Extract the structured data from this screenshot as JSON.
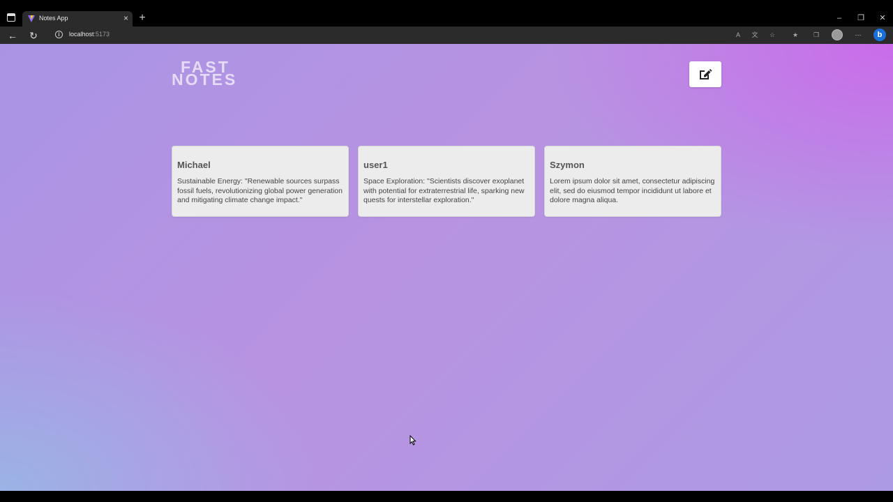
{
  "browser": {
    "tab_title": "Notes App",
    "tab_close": "×",
    "new_tab": "+",
    "url_host": "localhost",
    "url_port": ":5173",
    "window_minimize": "–",
    "window_restore": "❐",
    "window_close": "✕"
  },
  "app": {
    "logo_line1": "FAST",
    "logo_line2": "NOTES",
    "edit_icon": "pencil-square-icon",
    "background_colors": [
      "#a994e4",
      "#ce64eb",
      "#96b9e6"
    ]
  },
  "notes": [
    {
      "author": "Michael",
      "text": "Sustainable Energy: \"Renewable sources surpass fossil fuels, revolutionizing global power generation and mitigating climate change impact.\""
    },
    {
      "author": "user1",
      "text": "Space Exploration: \"Scientists discover exoplanet with potential for extraterrestrial life, sparking new quests for interstellar exploration.\""
    },
    {
      "author": "Szymon",
      "text": "Lorem ipsum dolor sit amet, consectetur adipiscing elit, sed do eiusmod tempor incididunt ut labore et dolore magna aliqua."
    }
  ]
}
